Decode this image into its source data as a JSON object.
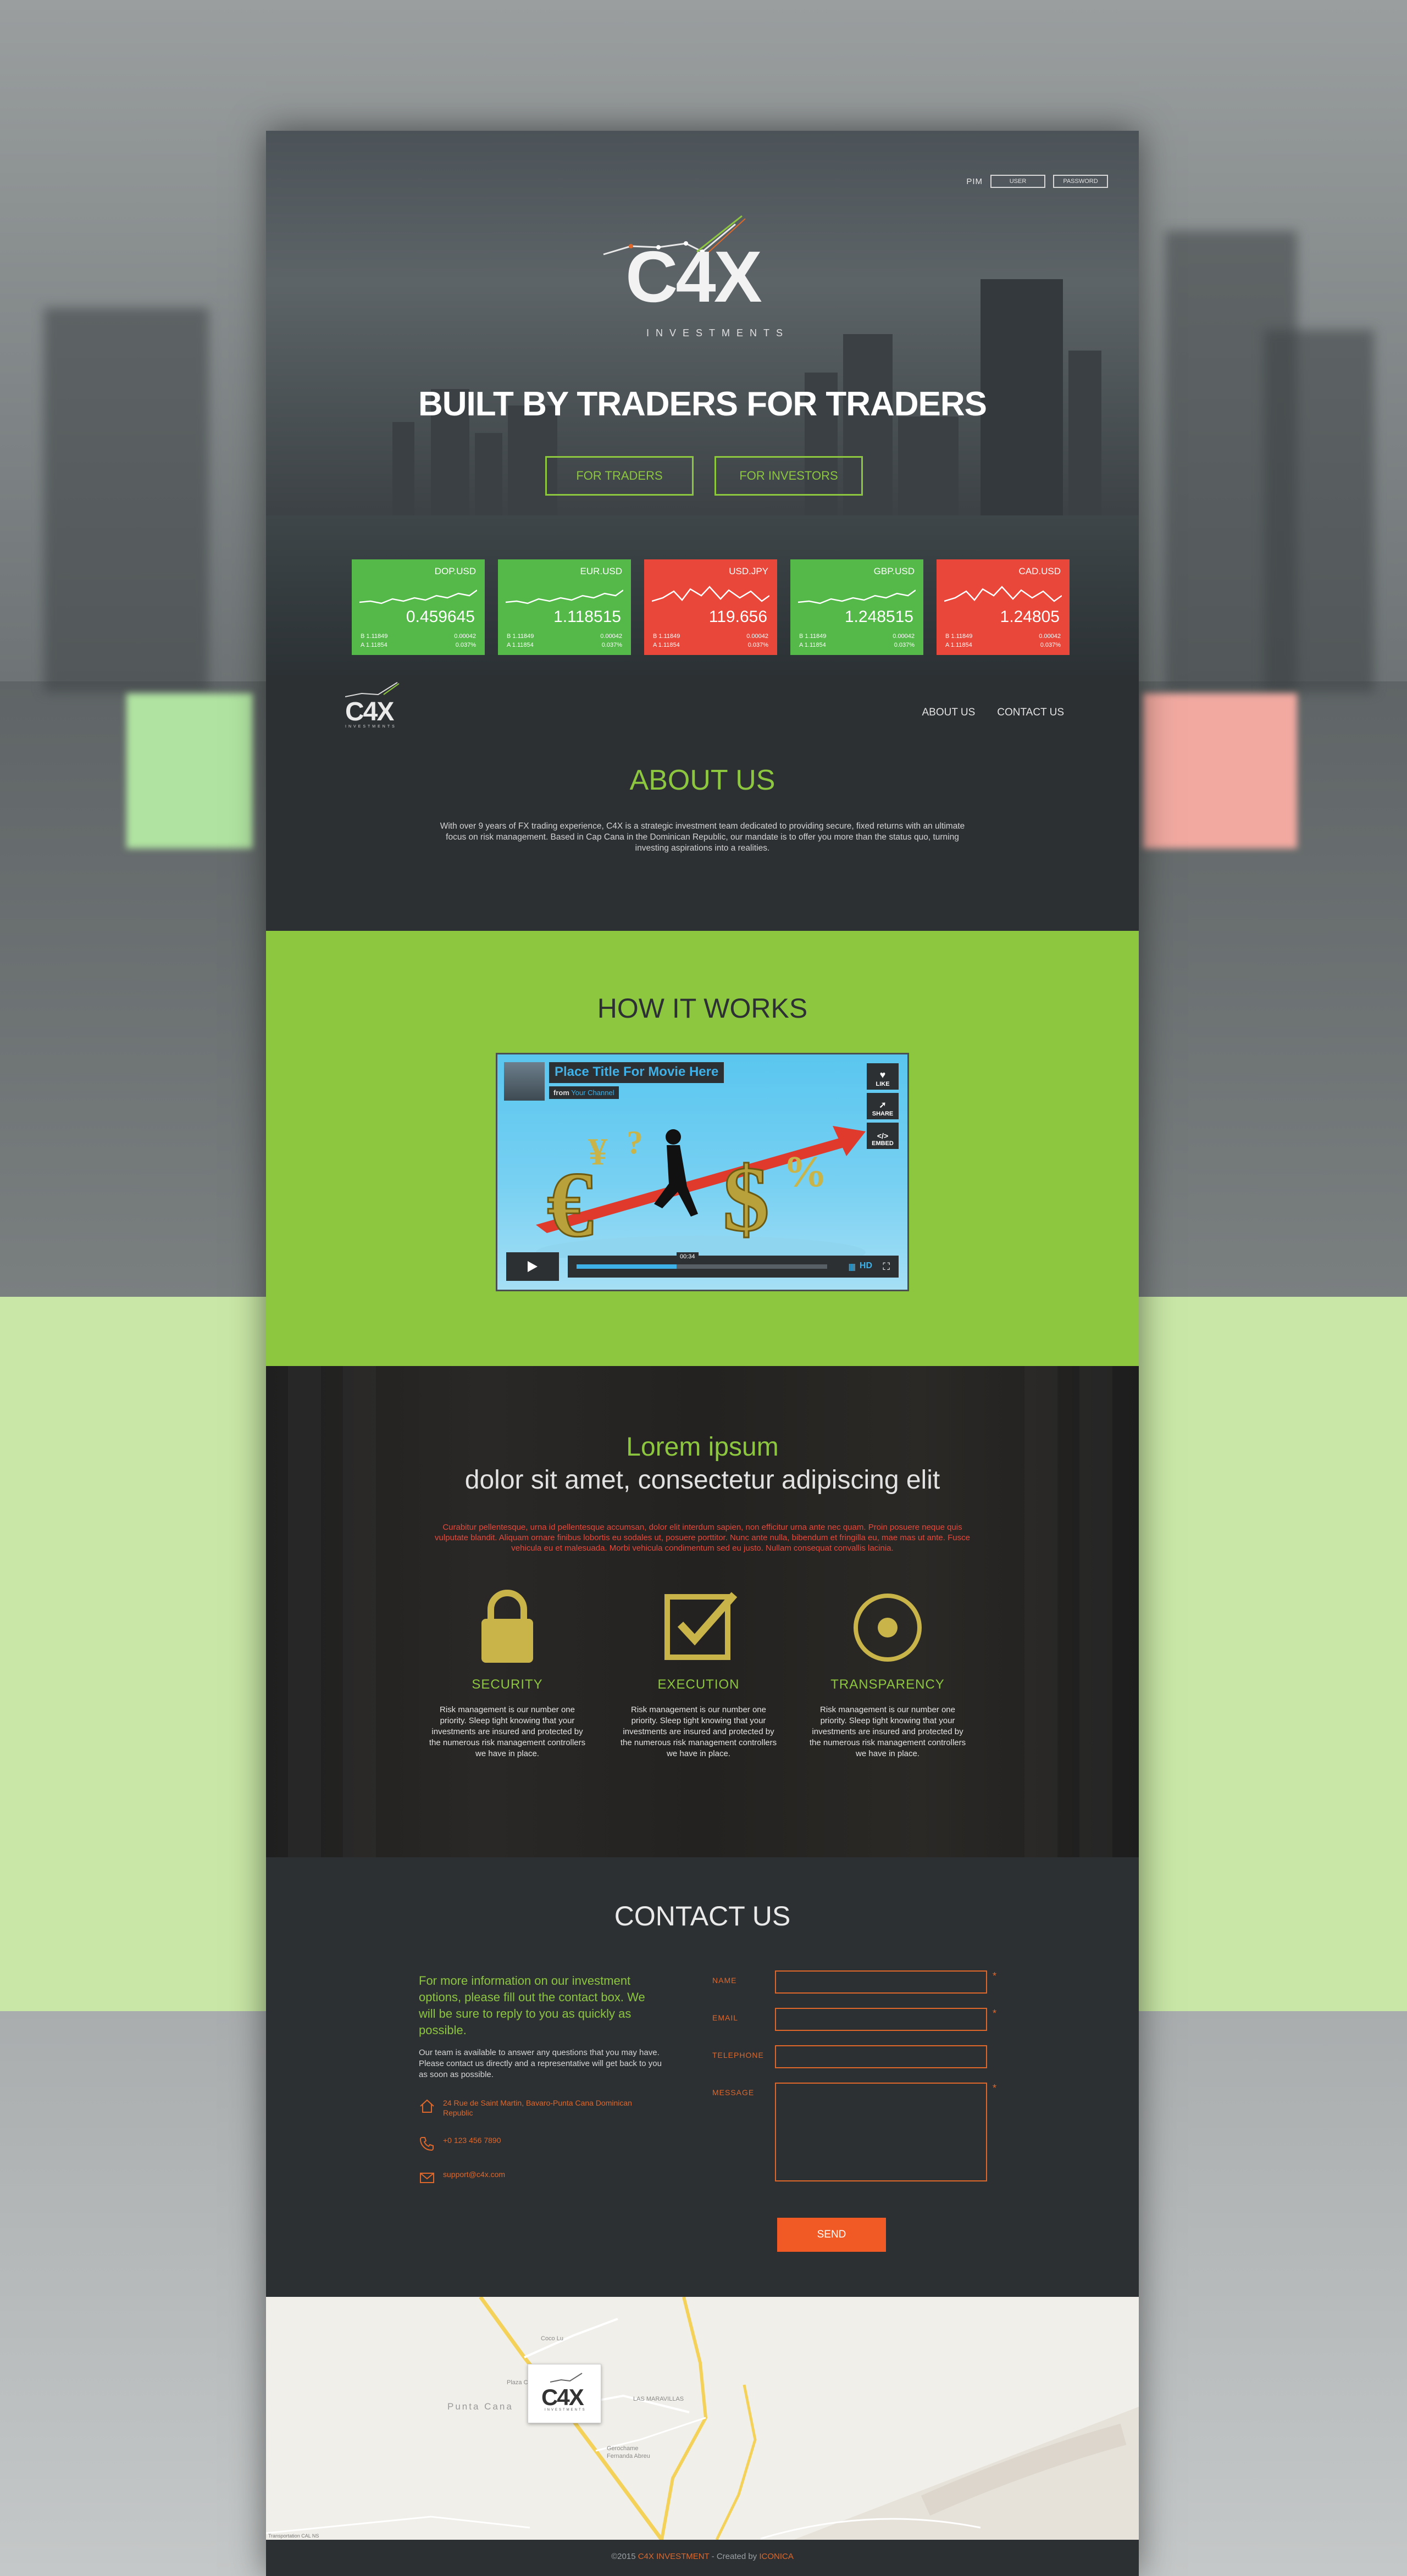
{
  "login": {
    "label": "PIM",
    "user_placeholder": "USER",
    "password_placeholder": "PASSWORD"
  },
  "brand": {
    "name": "C4X",
    "tagline": "INVESTMENTS"
  },
  "hero": {
    "title": "BUILT BY TRADERS FOR TRADERS",
    "btn_traders": "FOR TRADERS",
    "btn_investors": "FOR INVESTORS"
  },
  "tickers": [
    {
      "pair": "DOP.USD",
      "price": "0.459645",
      "b": "B 1.11849",
      "a": "A 1.11854",
      "v1": "0.00042",
      "v2": "0.037%",
      "trend": "up",
      "color": "#54b948"
    },
    {
      "pair": "EUR.USD",
      "price": "1.118515",
      "b": "B 1.11849",
      "a": "A 1.11854",
      "v1": "0.00042",
      "v2": "0.037%",
      "trend": "up",
      "color": "#54b948"
    },
    {
      "pair": "USD.JPY",
      "price": "119.656",
      "b": "B 1.11849",
      "a": "A 1.11854",
      "v1": "0.00042",
      "v2": "0.037%",
      "trend": "down",
      "color": "#e8473a"
    },
    {
      "pair": "GBP.USD",
      "price": "1.248515",
      "b": "B 1.11849",
      "a": "A 1.11854",
      "v1": "0.00042",
      "v2": "0.037%",
      "trend": "up",
      "color": "#54b948"
    },
    {
      "pair": "CAD.USD",
      "price": "1.24805",
      "b": "B 1.11849",
      "a": "A 1.11854",
      "v1": "0.00042",
      "v2": "0.037%",
      "trend": "down",
      "color": "#e8473a"
    }
  ],
  "nav": {
    "about": "ABOUT US",
    "contact": "CONTACT US"
  },
  "about": {
    "title": "ABOUT US",
    "text": "With over 9 years of FX trading experience, C4X is a strategic investment team dedicated to providing secure, fixed returns with an ultimate focus on risk management. Based in Cap Cana in the Dominican Republic, our mandate is to offer you more than the status quo, turning investing aspirations into a realities."
  },
  "how": {
    "title": "HOW IT WORKS",
    "video_title": "Place Title For Movie Here",
    "video_from": "from",
    "video_channel": "Your Channel",
    "like": "LIKE",
    "share": "SHARE",
    "embed": "EMBED",
    "time": "00:34",
    "hd": "HD",
    "progress": 0.4
  },
  "features": {
    "title1": "Lorem ipsum",
    "title2": "dolor sit amet, consectetur adipiscing elit",
    "lead": "Curabitur pellentesque, urna id pellentesque accumsan, dolor elit interdum sapien, non efficitur urna ante nec quam. Proin posuere neque quis vulputate blandit. Aliquam ornare finibus lobortis eu sodales ut, posuere porttitor. Nunc ante nulla, bibendum et fringilla eu, mae mas ut ante. Fusce vehicula eu et malesuada. Morbi vehicula condimentum sed eu justo. Nullam consequat convallis lacinia.",
    "items": [
      {
        "title": "SECURITY",
        "text": "Risk management is our number one priority. Sleep tight knowing that your investments are insured and protected by the numerous risk management controllers we have in place."
      },
      {
        "title": "EXECUTION",
        "text": "Risk management is our number one priority. Sleep tight knowing that your investments are insured and protected by the numerous risk management controllers we have in place."
      },
      {
        "title": "TRANSPARENCY",
        "text": "Risk management is our number one priority. Sleep tight knowing that your investments are insured and protected by the numerous risk management controllers we have in place."
      }
    ]
  },
  "contact": {
    "title": "CONTACT US",
    "intro": "For more information on our investment options, please fill out the contact box. We will be sure to reply to you as quickly as possible.",
    "body": "Our team is available to answer any questions that you may have. Please contact us directly and a representative will get back to you as soon as possible.",
    "address": "24 Rue de Saint Martin, Bavaro-Punta Cana Dominican Republic",
    "phone": "+0 123 456 7890",
    "email": "support@c4x.com",
    "fields": {
      "name": "NAME",
      "email": "EMAIL",
      "telephone": "TELEPHONE",
      "message": "MESSAGE"
    },
    "required": "*",
    "send": "SEND"
  },
  "map": {
    "city": "Punta Cana",
    "labels": [
      "Coco Lu",
      "Plaza Ca",
      "LAS MARAVILLAS",
      "Gerochame",
      "Fernanda Abreu"
    ],
    "attribution": "Transportation CAL NS"
  },
  "footer": {
    "copyright": "©2015",
    "company": "C4X INVESTMENT",
    "sep": " - ",
    "created": "Created by",
    "author": "ICONICA"
  }
}
